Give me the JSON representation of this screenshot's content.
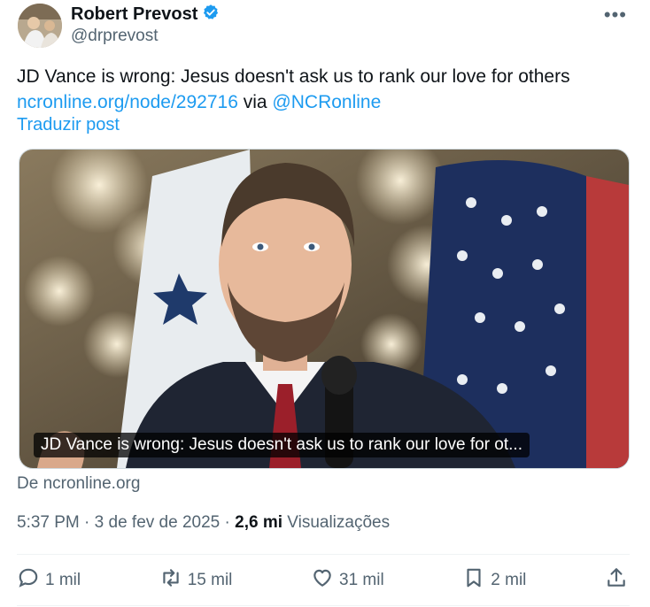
{
  "author": {
    "name": "Robert Prevost",
    "handle": "@drprevost"
  },
  "post": {
    "text": "JD Vance is wrong: Jesus doesn't ask us to rank our love for others",
    "link": "ncronline.org/node/292716",
    "via": "via",
    "mention": "@NCRonline",
    "translate": "Traduzir post"
  },
  "card": {
    "caption": "JD Vance is wrong: Jesus doesn't ask us to rank our love for ot...",
    "source": "De ncronline.org"
  },
  "meta": {
    "time": "5:37 PM",
    "date": "3 de fev de 2025",
    "views_count": "2,6 mi",
    "views_label": "Visualizações"
  },
  "actions": {
    "replies": "1 mil",
    "reposts": "15 mil",
    "likes": "31 mil",
    "bookmarks": "2 mil"
  },
  "colors": {
    "accent": "#1d9bf0",
    "secondary_text": "#536471",
    "verified": "#1d9bf0"
  },
  "icons": [
    "verified-badge-icon",
    "more-icon",
    "reply-icon",
    "repost-icon",
    "like-icon",
    "bookmark-icon",
    "share-icon"
  ]
}
